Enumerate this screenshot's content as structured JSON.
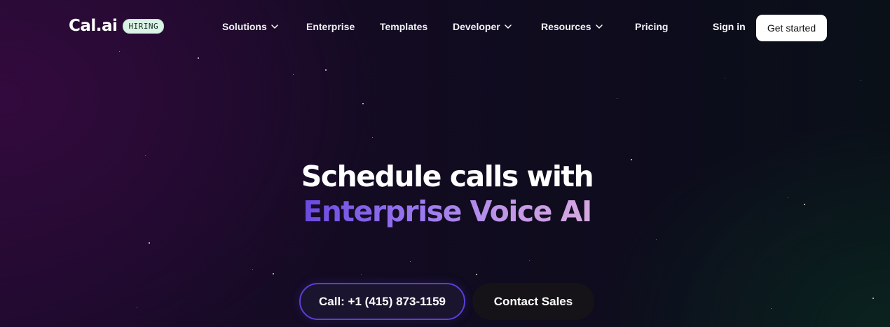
{
  "brand": {
    "logo_text": "Cal.ai",
    "badge": "HIRING"
  },
  "nav": {
    "items": [
      {
        "label": "Solutions",
        "has_dropdown": true
      },
      {
        "label": "Enterprise",
        "has_dropdown": false
      },
      {
        "label": "Templates",
        "has_dropdown": false
      },
      {
        "label": "Developer",
        "has_dropdown": true
      },
      {
        "label": "Resources",
        "has_dropdown": true
      },
      {
        "label": "Pricing",
        "has_dropdown": false
      }
    ],
    "sign_in": "Sign in",
    "get_started": "Get started"
  },
  "hero": {
    "line1": "Schedule calls with",
    "line2": "Enterprise Voice AI",
    "call_button": "Call: +1 (415) 873-1159",
    "sales_button": "Contact Sales"
  },
  "colors": {
    "accent_gradient_start": "#6a49e0",
    "accent_gradient_end": "#d6a8e0",
    "call_button_border": "#5b3fd6",
    "badge_bg": "#d9f3e6"
  },
  "icons": {
    "dropdown": "chevron-down-icon"
  }
}
